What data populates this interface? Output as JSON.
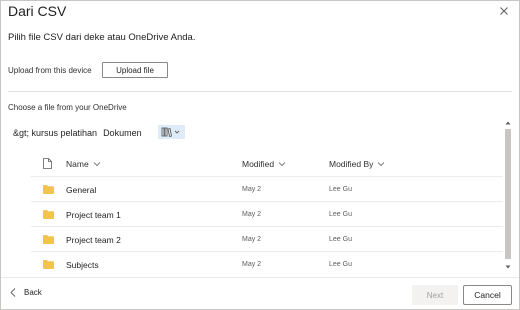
{
  "dialog": {
    "title": "Dari CSV",
    "subtitle": "Pilih file CSV dari deke atau OneDrive Anda."
  },
  "upload": {
    "label": "Upload from this device",
    "button_label": "Upload file"
  },
  "onedrive": {
    "label": "Choose a file from your OneDrive",
    "breadcrumb": [
      "&gt; kursus pelatihan",
      "Dokumen"
    ]
  },
  "table": {
    "columns": [
      "Name",
      "Modified",
      "Modified By"
    ],
    "rows": [
      {
        "name": "General",
        "modified": "May 2",
        "modified_by": "Lee Gu"
      },
      {
        "name": "Project team 1",
        "modified": "May 2",
        "modified_by": "Lee Gu"
      },
      {
        "name": "Project team 2",
        "modified": "May 2",
        "modified_by": "Lee Gu"
      },
      {
        "name": "Subjects",
        "modified": "May 2",
        "modified_by": "Lee Gu"
      }
    ]
  },
  "footer": {
    "back_label": "Back",
    "next_label": "Next",
    "cancel_label": "Cancel"
  },
  "colors": {
    "folder": "#f2c34d",
    "view_button_bg": "#deecf9",
    "accent": "#0078d4"
  },
  "icons": {
    "close": "close-icon",
    "view": "library-view-icon",
    "file": "file-icon",
    "folder": "folder-icon",
    "back": "chevron-left-icon"
  }
}
